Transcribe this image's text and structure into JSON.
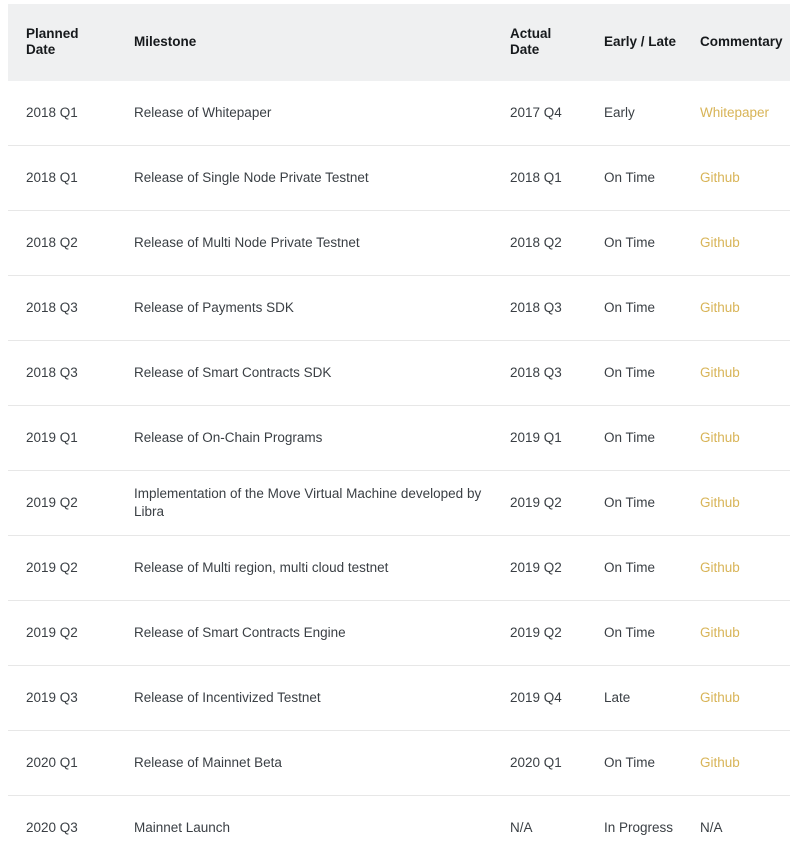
{
  "table": {
    "columns": [
      {
        "key": "planned_date",
        "label": "Planned\nDate"
      },
      {
        "key": "milestone",
        "label": "Milestone"
      },
      {
        "key": "actual_date",
        "label": "Actual\nDate"
      },
      {
        "key": "early_late",
        "label": "Early / Late"
      },
      {
        "key": "commentary",
        "label": "Commentary"
      }
    ],
    "header_labels": {
      "planned_date_line1": "Planned",
      "planned_date_line2": "Date",
      "milestone": "Milestone",
      "actual_date_line1": "Actual",
      "actual_date_line2": "Date",
      "early_late": "Early / Late",
      "commentary": "Commentary"
    },
    "rows": [
      {
        "planned_date": "2018 Q1",
        "milestone": "Release of Whitepaper",
        "actual_date": "2017 Q4",
        "early_late": "Early",
        "commentary": "Whitepaper",
        "commentary_is_link": true
      },
      {
        "planned_date": "2018 Q1",
        "milestone": "Release of Single Node Private Testnet",
        "actual_date": "2018 Q1",
        "early_late": "On Time",
        "commentary": "Github",
        "commentary_is_link": true
      },
      {
        "planned_date": "2018 Q2",
        "milestone": "Release of Multi Node Private Testnet",
        "actual_date": "2018 Q2",
        "early_late": "On Time",
        "commentary": "Github",
        "commentary_is_link": true
      },
      {
        "planned_date": "2018 Q3",
        "milestone": "Release of Payments SDK",
        "actual_date": "2018 Q3",
        "early_late": "On Time",
        "commentary": "Github",
        "commentary_is_link": true
      },
      {
        "planned_date": "2018 Q3",
        "milestone": "Release of Smart Contracts SDK",
        "actual_date": "2018 Q3",
        "early_late": "On Time",
        "commentary": "Github",
        "commentary_is_link": true
      },
      {
        "planned_date": "2019 Q1",
        "milestone": "Release of On-Chain Programs",
        "actual_date": "2019 Q1",
        "early_late": "On Time",
        "commentary": "Github",
        "commentary_is_link": true
      },
      {
        "planned_date": "2019 Q2",
        "milestone": "Implementation of the Move Virtual Machine developed by Libra",
        "actual_date": "2019 Q2",
        "early_late": "On Time",
        "commentary": "Github",
        "commentary_is_link": true
      },
      {
        "planned_date": "2019 Q2",
        "milestone": "Release of Multi region, multi cloud testnet",
        "actual_date": "2019 Q2",
        "early_late": "On Time",
        "commentary": "Github",
        "commentary_is_link": true
      },
      {
        "planned_date": "2019 Q2",
        "milestone": "Release of Smart Contracts Engine",
        "actual_date": "2019 Q2",
        "early_late": "On Time",
        "commentary": "Github",
        "commentary_is_link": true
      },
      {
        "planned_date": "2019 Q3",
        "milestone": "Release of Incentivized Testnet",
        "actual_date": "2019 Q4",
        "early_late": "Late",
        "commentary": "Github",
        "commentary_is_link": true
      },
      {
        "planned_date": "2020 Q1",
        "milestone": "Release of Mainnet Beta",
        "actual_date": "2020 Q1",
        "early_late": "On Time",
        "commentary": "Github",
        "commentary_is_link": true
      },
      {
        "planned_date": "2020 Q3",
        "milestone": "Mainnet Launch",
        "actual_date": "N/A",
        "early_late": "In Progress",
        "commentary": "N/A",
        "commentary_is_link": false
      }
    ]
  },
  "colors": {
    "header_background": "#eff0f1",
    "link": "#d8b457",
    "text": "#3a3f44",
    "row_divider": "#e7e7e7",
    "page_background": "#ffffff"
  }
}
